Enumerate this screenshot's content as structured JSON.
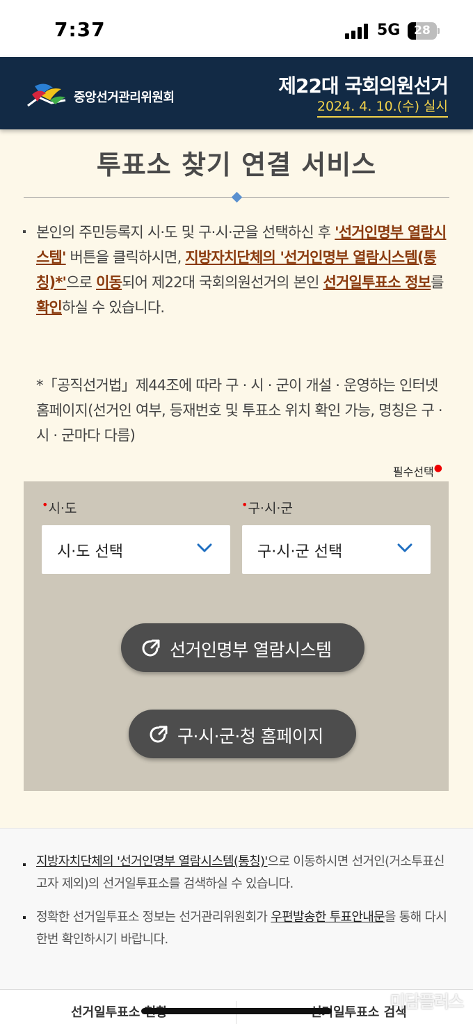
{
  "status_bar": {
    "time": "7:37",
    "network": "5G",
    "battery": "28",
    "battery_level": 0.28
  },
  "header": {
    "org_name": "중앙선거관리위원회",
    "election_title": "제22대 국회의원선거",
    "election_date": "2024. 4. 10.(수) 실시"
  },
  "page": {
    "title": "투표소 찾기 연결 서비스"
  },
  "description": {
    "p1": "본인의 주민등록지 시·도 및 구·시·군을 선택하신 후 ",
    "h1": "'선거인명부 열람시스템'",
    "p2": " 버튼을 클릭하시면, ",
    "h2": "지방자치단체의 '선거인명부 열람시스템(통칭)*'",
    "p3": "으로 ",
    "h3": "이동",
    "p4": "되어 제22대 국회의원선거의 본인 ",
    "h4": "선거일투표소 정보",
    "p5": "를 ",
    "h5": "확인",
    "p6": "하실 수 있습니다.",
    "note": "*「공직선거법」제44조에 따라 구 · 시 · 군이 개설 · 운영하는 인터넷 홈페이지(선거인 여부, 등재번호 및 투표소 위치 확인 가능, 명칭은 구 · 시 · 군마다 다름)"
  },
  "form": {
    "required_note": "필수선택",
    "sido_label": "시·도",
    "sido_value": "시·도 선택",
    "gusigun_label": "구·시·군",
    "gusigun_value": "구·시·군 선택",
    "btn_voter_list": "선거인명부 열람시스템",
    "btn_homepage": "구·시·군·청 홈페이지"
  },
  "info": {
    "item1_link": "지방자치단체의 '선거인명부 열람시스템(통칭)'",
    "item1_rest": "으로 이동하시면 선거인(거소투표신고자 제외)의 선거일투표소를 검색하실 수 있습니다.",
    "item2_a": "정확한 선거일투표소 정보는 선거관리위원회가 ",
    "item2_link": "우편발송한 투표안내문",
    "item2_b": "을 통해 다시 한번 확인하시기 바랍니다."
  },
  "tabs": {
    "left": "선거일투표소 현황",
    "right": "선거일투표소 검색"
  },
  "watermark": "미담플러스",
  "colors": {
    "header_bg": "#122a45",
    "accent_yellow": "#f3d34a",
    "highlight_brown": "#8a3a0e",
    "panel_bg": "#cdc7b9",
    "button_bg": "#4d4d4d",
    "chevron_blue": "#1f6fc1"
  }
}
